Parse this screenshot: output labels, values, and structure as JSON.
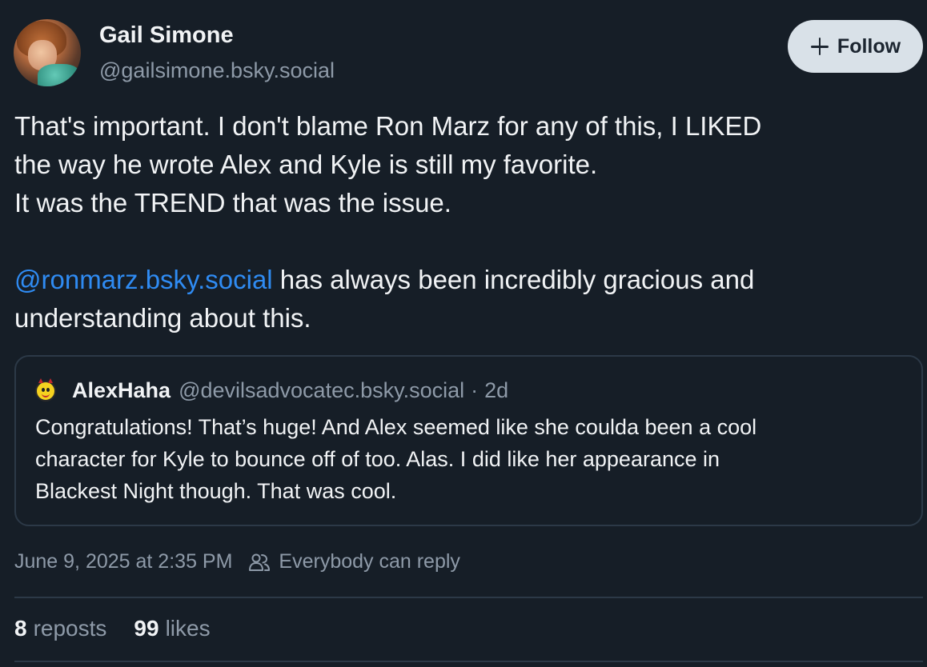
{
  "author": {
    "display_name": "Gail Simone",
    "handle": "@gailsimone.bsky.social"
  },
  "follow_button": {
    "label": "Follow",
    "icon": "plus-icon"
  },
  "post": {
    "lines": [
      "That's important. I don't blame Ron Marz for any of this, I LIKED",
      "the way he wrote Alex and Kyle is still my favorite.",
      "It was the TREND that was the issue."
    ],
    "mention": "@ronmarz.bsky.social",
    "mention_rest": " has always been incredibly gracious and",
    "last_line": "understanding about this."
  },
  "quote": {
    "avatar_icon": "devil-smiley-icon",
    "name": "AlexHaha",
    "handle": "@devilsadvocatec.bsky.social",
    "separator": "·",
    "time": "2d",
    "lines": [
      "Congratulations! That’s huge! And Alex seemed like she coulda been a cool",
      "character for Kyle to bounce off of too. Alas. I did like her appearance in",
      "Blackest Night though. That was cool."
    ]
  },
  "meta": {
    "timestamp": "June 9, 2025 at 2:35 PM",
    "reply_icon": "people-icon",
    "reply_setting": "Everybody can reply"
  },
  "stats": {
    "reposts_count": "8",
    "reposts_label": "reposts",
    "likes_count": "99",
    "likes_label": "likes"
  },
  "colors": {
    "background": "#161e27",
    "accent_link": "#2f8bf2",
    "muted_text": "#8e9aa8",
    "follow_button_bg": "#d9e1e8"
  }
}
